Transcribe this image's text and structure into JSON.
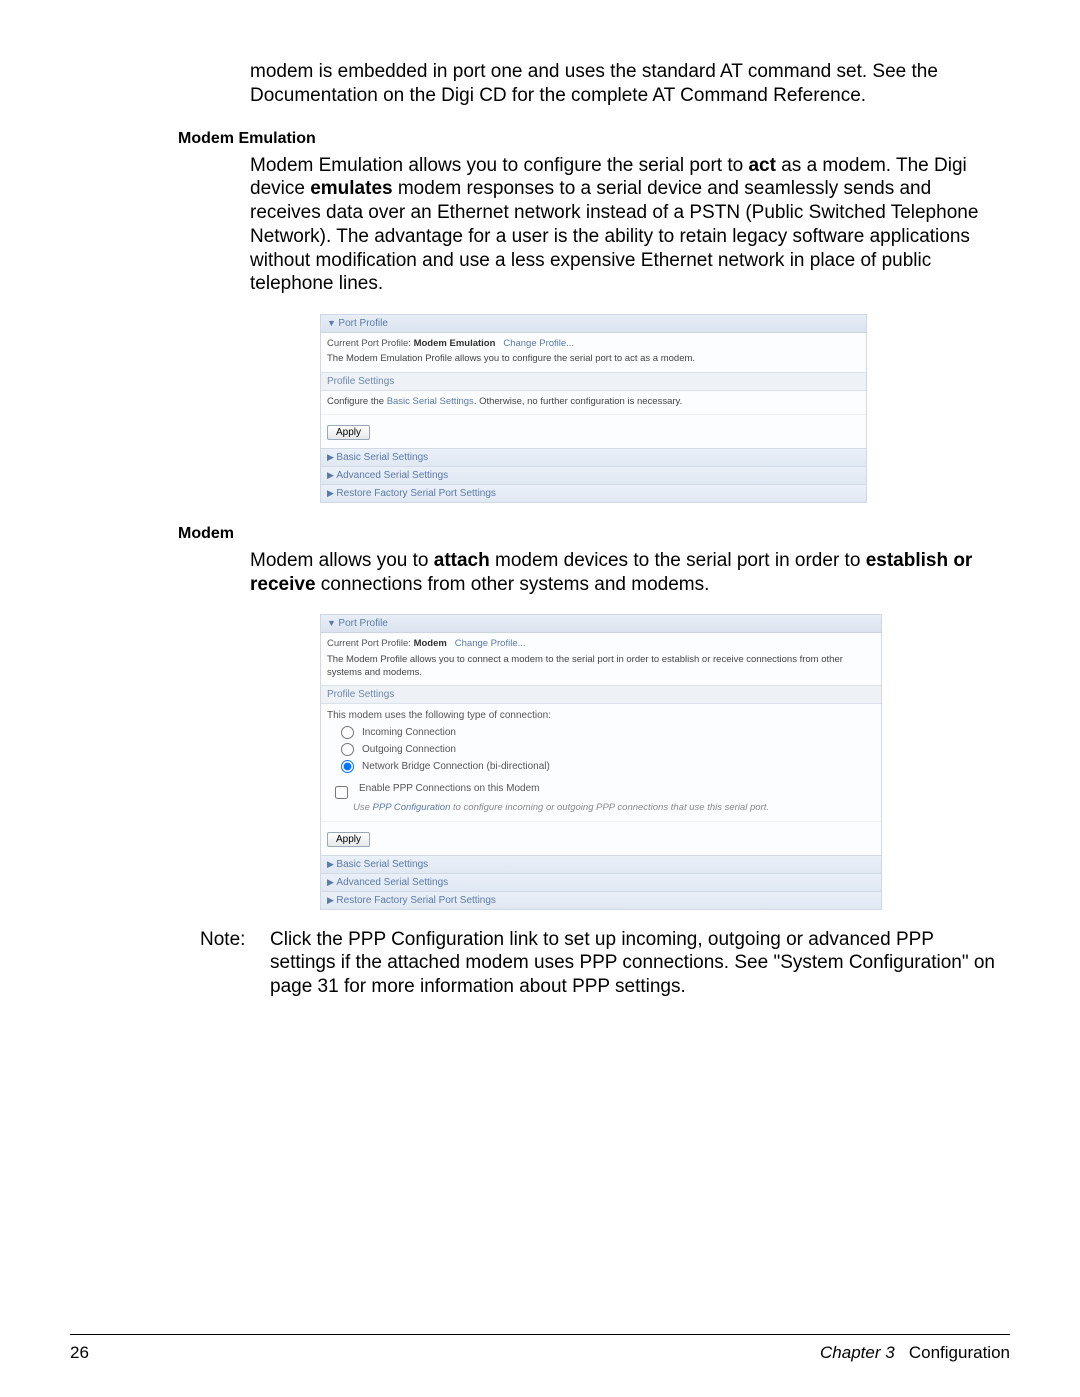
{
  "intro_para": "modem is embedded in port one and uses the standard AT command set. See the Documentation on the Digi CD for the complete AT Command Reference.",
  "heading1": "Modem Emulation",
  "para1_pre": "Modem Emulation allows you to configure the serial port to ",
  "para1_b1": "act",
  "para1_mid": " as a modem. The Digi device ",
  "para1_b2": "emulates",
  "para1_post": " modem responses to a serial device and seamlessly sends and receives data over an Ethernet network instead of a PSTN (Public Switched Telephone Network). The advantage for a user is the ability to retain legacy software applications without modification and use a less expensive Ethernet network in place of public telephone lines.",
  "panel1": {
    "header": "Port Profile",
    "cur_label": "Current Port Profile:",
    "cur_name": "Modem Emulation",
    "change": "Change Profile...",
    "desc": "The Modem Emulation Profile allows you to configure the serial port to act as a modem.",
    "settings": "Profile Settings",
    "settings_body_pre": "Configure the ",
    "settings_link": "Basic Serial Settings",
    "settings_body_post": ". Otherwise, no further configuration is necessary.",
    "apply": "Apply",
    "rows": [
      "Basic Serial Settings",
      "Advanced Serial Settings",
      "Restore Factory Serial Port Settings"
    ]
  },
  "heading2": "Modem",
  "para2_pre": "Modem allows you to ",
  "para2_b1": "attach",
  "para2_mid": " modem devices to the serial port in order to ",
  "para2_b2": "establish or receive",
  "para2_post": " connections from other systems and modems.",
  "panel2": {
    "header": "Port Profile",
    "cur_label": "Current Port Profile:",
    "cur_name": "Modem",
    "change": "Change Profile...",
    "desc": "The Modem Profile allows you to connect a modem to the serial port in order to establish or receive connections from other systems and modems.",
    "settings": "Profile Settings",
    "conn_intro": "This modem uses the following type of connection:",
    "radios": [
      "Incoming Connection",
      "Outgoing Connection",
      "Network Bridge Connection (bi-directional)"
    ],
    "checkbox": "Enable PPP Connections on this Modem",
    "hint_pre": "Use ",
    "hint_link": "PPP Configuration",
    "hint_post": " to configure incoming or outgoing PPP connections that use this serial port.",
    "apply": "Apply",
    "rows": [
      "Basic Serial Settings",
      "Advanced Serial Settings",
      "Restore Factory Serial Port Settings"
    ]
  },
  "note_label": "Note:",
  "note_text": "Click the PPP Configuration link to set up incoming, outgoing or advanced PPP settings if the attached modem uses PPP connections.  See \"System Configuration\" on page 31 for more information about PPP settings.",
  "footer": {
    "page": "26",
    "chapter": "Chapter 3",
    "title": "Configuration"
  }
}
